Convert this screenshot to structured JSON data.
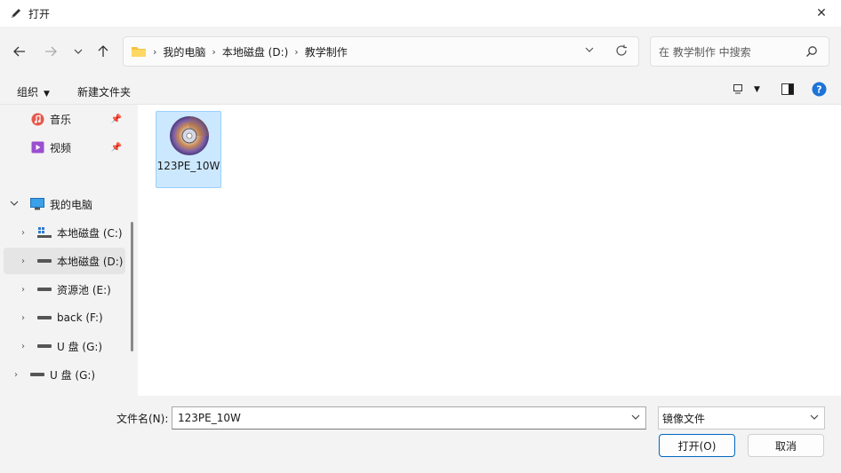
{
  "window": {
    "title": "打开"
  },
  "address": {
    "crumbs": [
      "我的电脑",
      "本地磁盘 (D:)",
      "教学制作"
    ]
  },
  "search": {
    "placeholder": "在 教学制作 中搜索"
  },
  "toolbar": {
    "organize_label": "组织",
    "new_folder_label": "新建文件夹"
  },
  "sidebar": {
    "quick": [
      {
        "label": "音乐",
        "icon": "music-icon"
      },
      {
        "label": "视频",
        "icon": "video-icon"
      }
    ],
    "this_pc": {
      "label": "我的电脑",
      "icon": "computer-icon"
    },
    "drives": [
      {
        "label": "本地磁盘 (C:)",
        "icon": "windows-drive-icon"
      },
      {
        "label": "本地磁盘 (D:)",
        "icon": "drive-icon"
      },
      {
        "label": "资源池 (E:)",
        "icon": "drive-icon"
      },
      {
        "label": "back (F:)",
        "icon": "drive-icon"
      },
      {
        "label": "U 盘 (G:)",
        "icon": "usb-drive-icon"
      }
    ],
    "external": {
      "label": "U 盘 (G:)",
      "icon": "usb-drive-icon"
    }
  },
  "files": [
    {
      "name": "123PE_10W",
      "icon": "disc-image-icon"
    }
  ],
  "footer": {
    "filename_label": "文件名(N):",
    "filename_value": "123PE_10W",
    "filetype_value": "镜像文件",
    "open_label": "打开(O)",
    "cancel_label": "取消"
  },
  "colors": {
    "accent": "#0067c0",
    "selection": "#cce8ff",
    "selection_border": "#99d1ff"
  }
}
